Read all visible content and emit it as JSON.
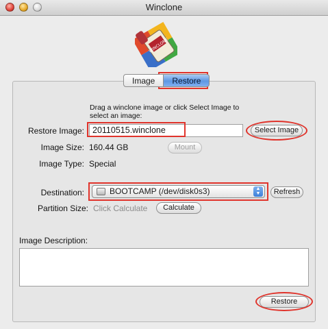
{
  "window": {
    "title": "Winclone"
  },
  "tabs": [
    {
      "label": "Image"
    },
    {
      "label": "Restore"
    }
  ],
  "restore": {
    "hint": "Drag a winclone image or click Select Image to select an image:",
    "restore_image_label": "Restore Image:",
    "restore_image_value": "20110515.winclone",
    "select_image_button": "Select Image",
    "image_size_label": "Image Size:",
    "image_size_value": "160.44 GB",
    "mount_button": "Mount",
    "image_type_label": "Image Type:",
    "image_type_value": "Special",
    "destination_label": "Destination:",
    "destination_value": "BOOTCAMP (/dev/disk0s3)",
    "refresh_button": "Refresh",
    "partition_size_label": "Partition Size:",
    "partition_size_value": "Click Calculate",
    "calculate_button": "Calculate",
    "image_description_label": "Image Description:",
    "image_description_value": "",
    "restore_button": "Restore"
  },
  "icons": {
    "app_logo": "winclone-logo",
    "disk": "hard-disk-icon",
    "popup_arrows": "popup-arrows-icon"
  },
  "colors": {
    "annotation_red": "#e0332b",
    "selected_tab": "#5e97e3"
  }
}
